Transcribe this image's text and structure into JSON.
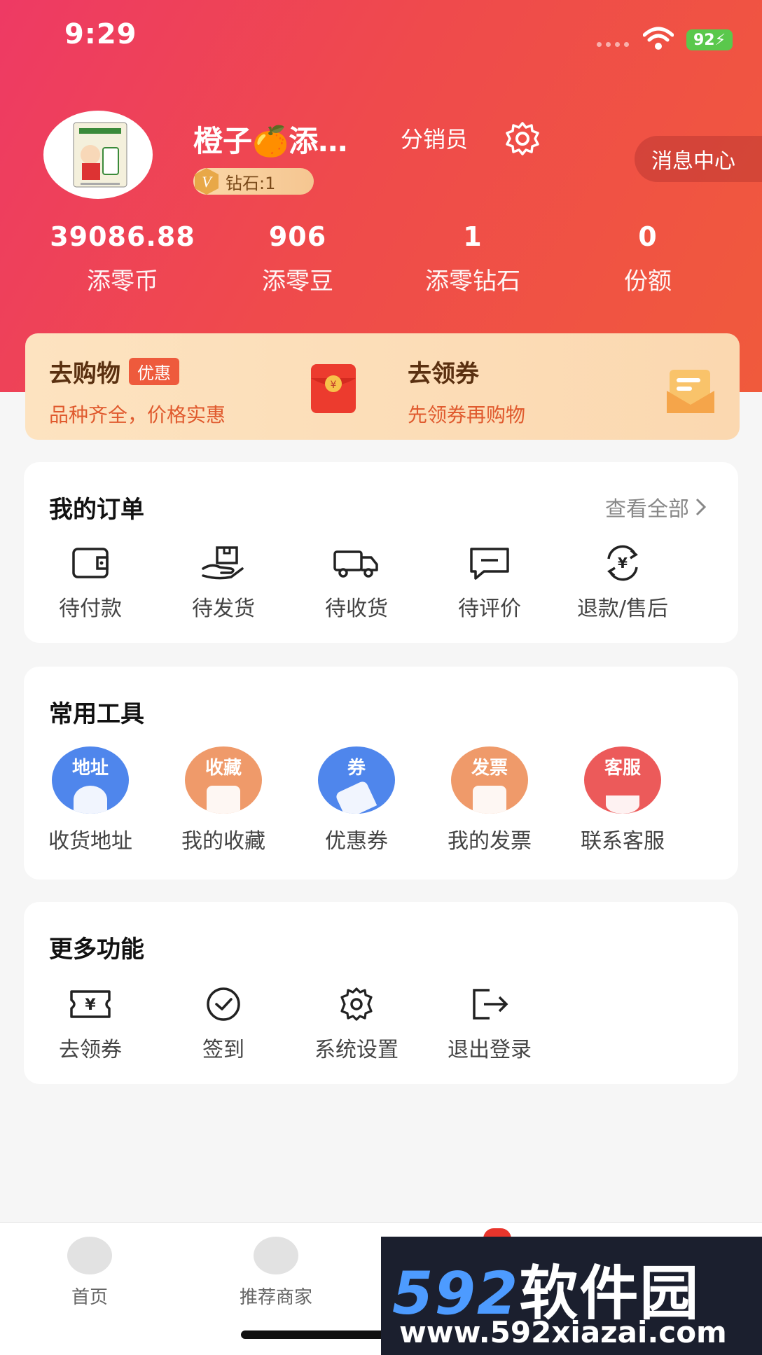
{
  "status_bar": {
    "time": "9:29",
    "battery": "92"
  },
  "profile": {
    "nickname": "橙子🍊添…",
    "role": "分销员",
    "level_badge": "钻石:1",
    "message_center": "消息中心"
  },
  "stats": [
    {
      "value": "39086.88",
      "label": "添零币"
    },
    {
      "value": "906",
      "label": "添零豆"
    },
    {
      "value": "1",
      "label": "添零钻石"
    },
    {
      "value": "0",
      "label": "份额"
    }
  ],
  "promo": {
    "shop": {
      "title": "去购物",
      "tag": "优惠",
      "subtitle": "品种齐全，价格实惠"
    },
    "coupon": {
      "title": "去领券",
      "subtitle": "先领券再购物"
    }
  },
  "orders": {
    "title": "我的订单",
    "view_all": "查看全部",
    "items": [
      {
        "label": "待付款",
        "icon": "wallet-icon"
      },
      {
        "label": "待发货",
        "icon": "package-hand-icon"
      },
      {
        "label": "待收货",
        "icon": "truck-icon"
      },
      {
        "label": "待评价",
        "icon": "comment-icon"
      },
      {
        "label": "退款/售后",
        "icon": "refund-icon"
      }
    ]
  },
  "tools": {
    "title": "常用工具",
    "items": [
      {
        "label": "收货地址",
        "badge": "地址",
        "color": "#4f86ec"
      },
      {
        "label": "我的收藏",
        "badge": "收藏",
        "color": "#ef9a6a"
      },
      {
        "label": "优惠券",
        "badge": "券",
        "color": "#4f86ec"
      },
      {
        "label": "我的发票",
        "badge": "发票",
        "color": "#ef9a6a"
      },
      {
        "label": "联系客服",
        "badge": "客服",
        "color": "#ec5a5a"
      }
    ]
  },
  "more": {
    "title": "更多功能",
    "items": [
      {
        "label": "去领券",
        "icon": "ticket-icon"
      },
      {
        "label": "签到",
        "icon": "check-circle-icon"
      },
      {
        "label": "系统设置",
        "icon": "gear-icon"
      },
      {
        "label": "退出登录",
        "icon": "logout-icon"
      }
    ]
  },
  "tabbar": [
    {
      "label": "首页"
    },
    {
      "label": "推荐商家"
    }
  ],
  "watermark": {
    "brand_num": "592",
    "brand_cn": "软件园",
    "url": "www.592xiazai.com"
  },
  "colors": {
    "hero_start": "#ee3a64",
    "hero_end": "#f05a3c",
    "accent": "#e05a2e"
  }
}
